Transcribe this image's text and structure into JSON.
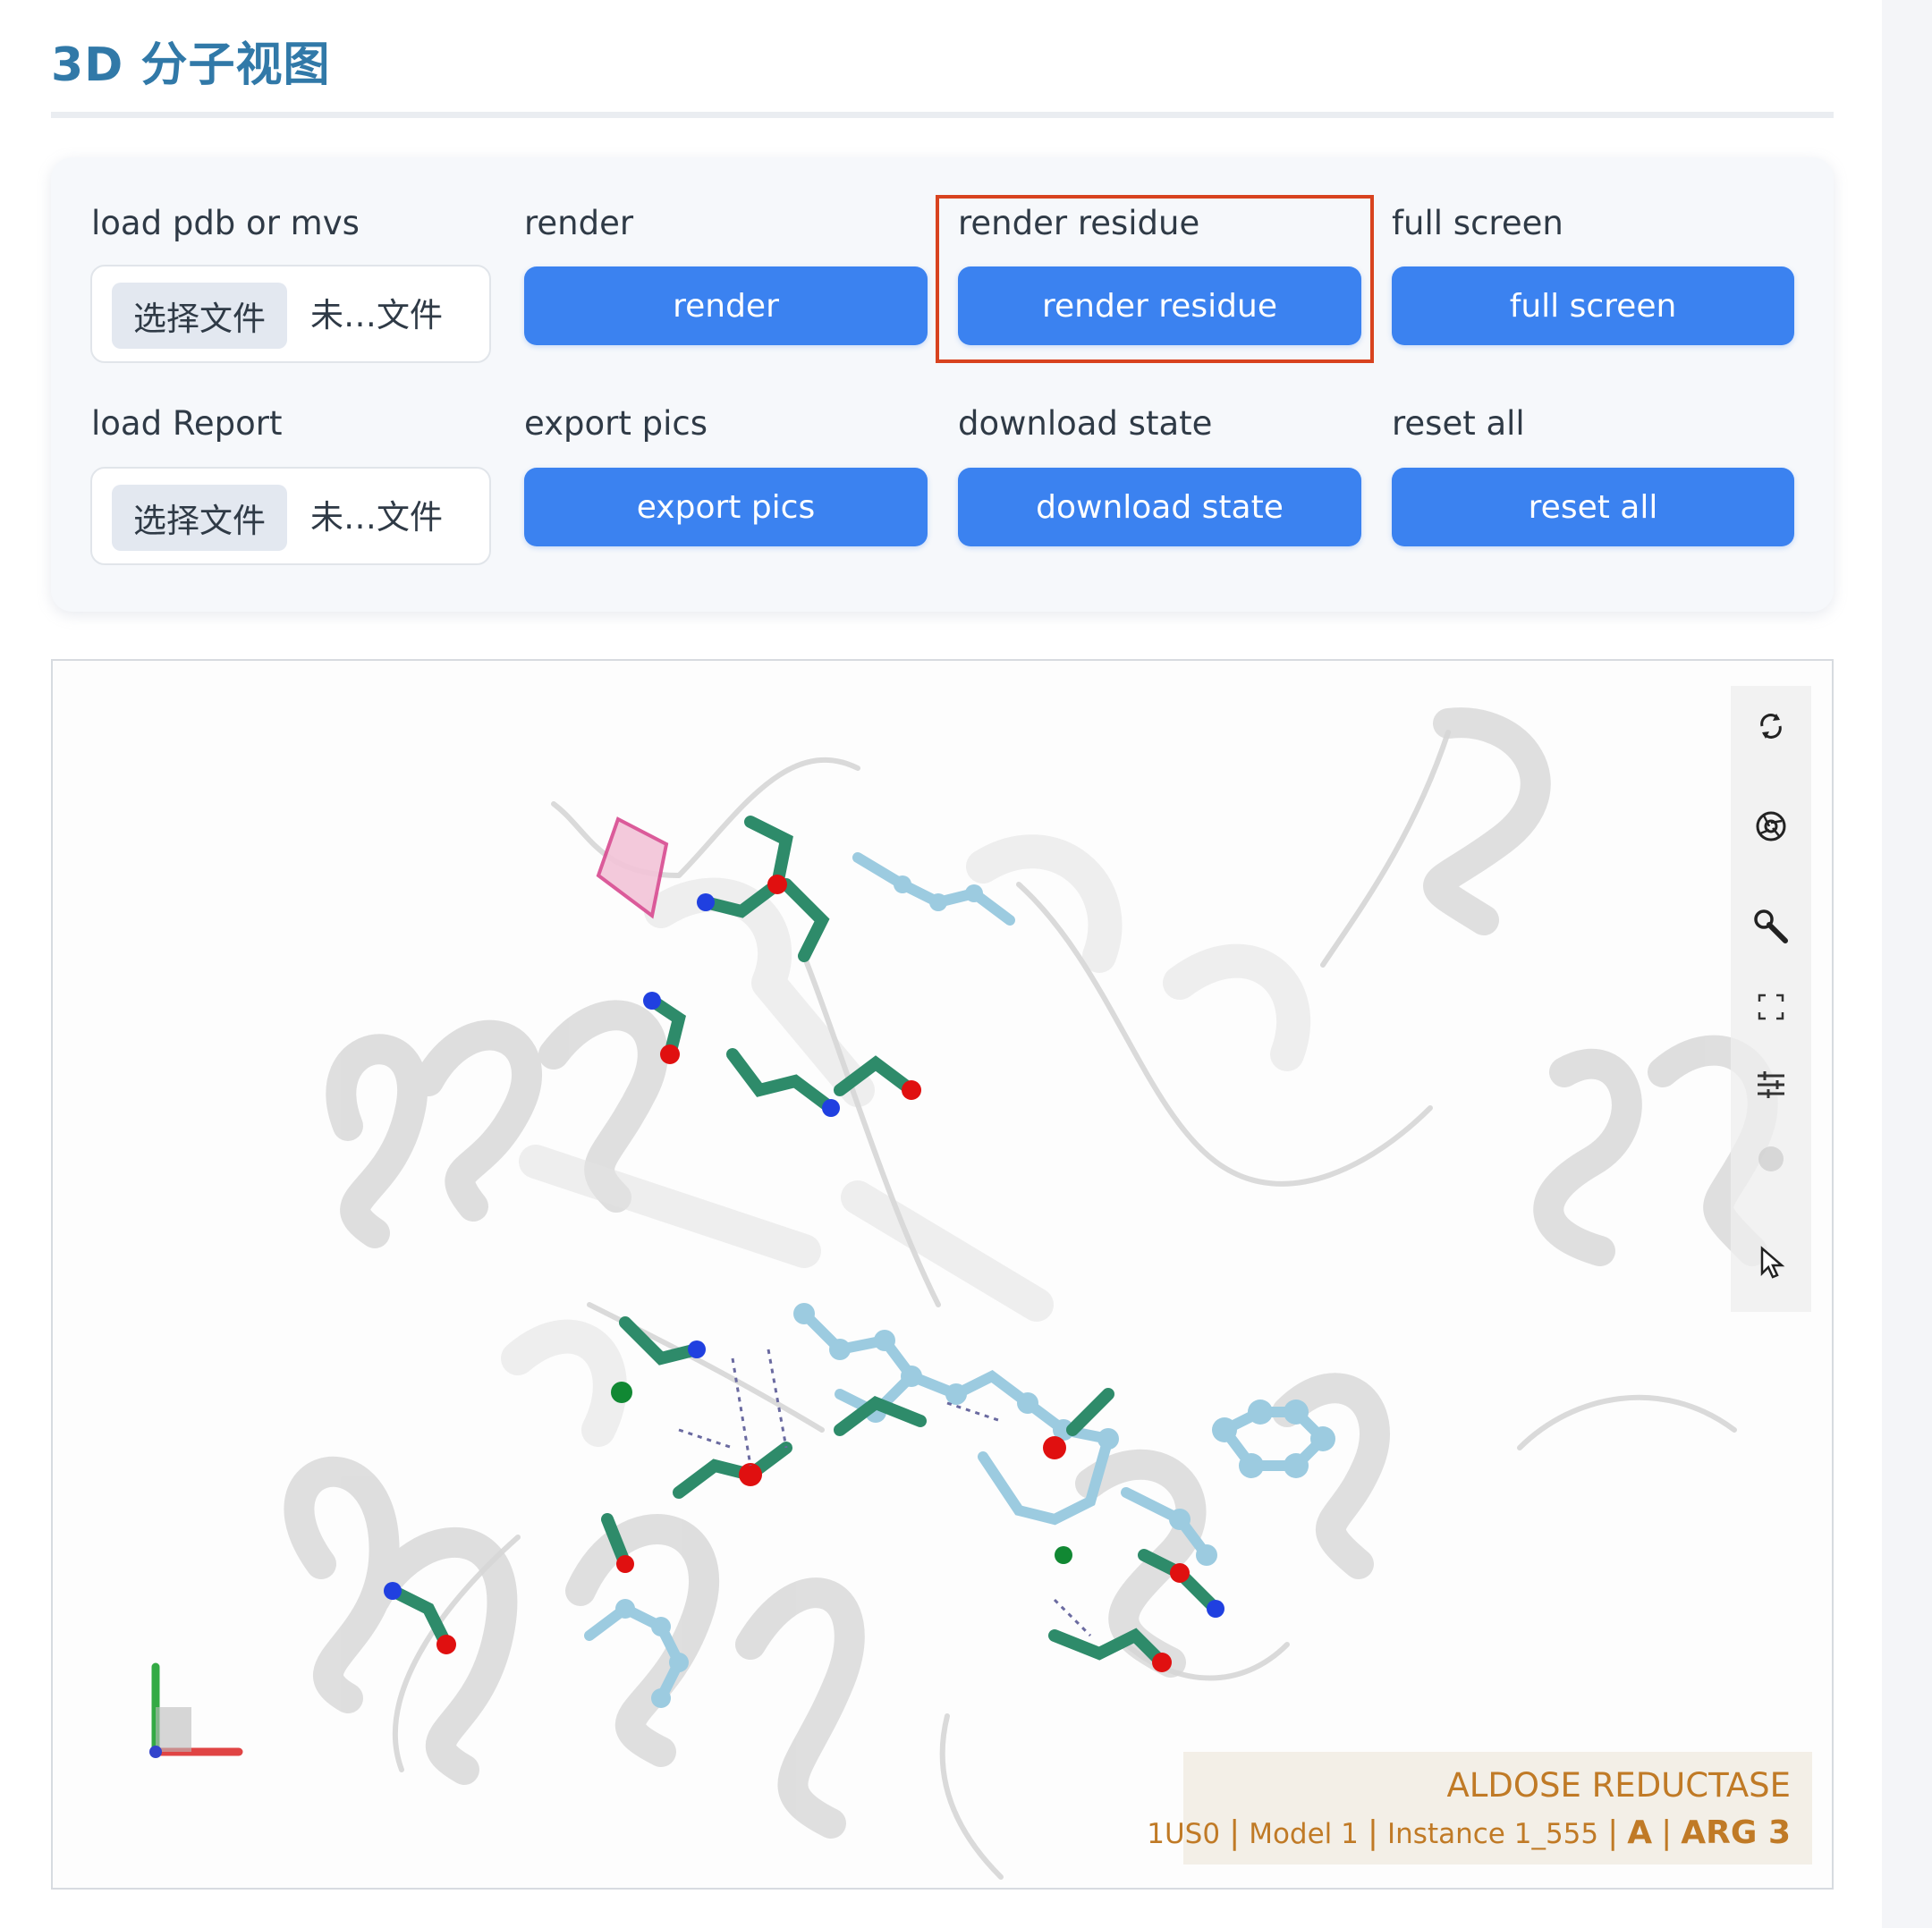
{
  "page": {
    "title": "3D 分子视图"
  },
  "controls": {
    "load_pdb": {
      "label": "load pdb or mvs",
      "button": "选择文件",
      "status": "未…文件"
    },
    "render": {
      "label": "render",
      "button": "render"
    },
    "render_residue": {
      "label": "render residue",
      "button": "render residue"
    },
    "full_screen": {
      "label": "full screen",
      "button": "full screen"
    },
    "load_report": {
      "label": "load Report",
      "button": "选择文件",
      "status": "未…文件"
    },
    "export_pics": {
      "label": "export pics",
      "button": "export pics"
    },
    "download_state": {
      "label": "download state",
      "button": "download state"
    },
    "reset_all": {
      "label": "reset all",
      "button": "reset all"
    }
  },
  "viewer": {
    "toolbar": [
      "reset-camera-icon",
      "screenshot-icon",
      "settings-wrench-icon",
      "expand-icon",
      "controls-sliders-icon",
      "toggle-icon",
      "selection-pointer-icon"
    ],
    "info": {
      "title": "ALDOSE REDUCTASE",
      "pdb": "1US0",
      "model": "Model 1",
      "instance": "Instance 1_555",
      "chain": "A",
      "residue": "ARG 3"
    },
    "colors": {
      "ribbon": "#d9d9d9",
      "residue_carbon": "#2e8b6a",
      "ligand": "#9ccbe0",
      "oxygen": "#e01010",
      "nitrogen": "#2040e0",
      "accent_highlight": "#d8431f"
    }
  }
}
